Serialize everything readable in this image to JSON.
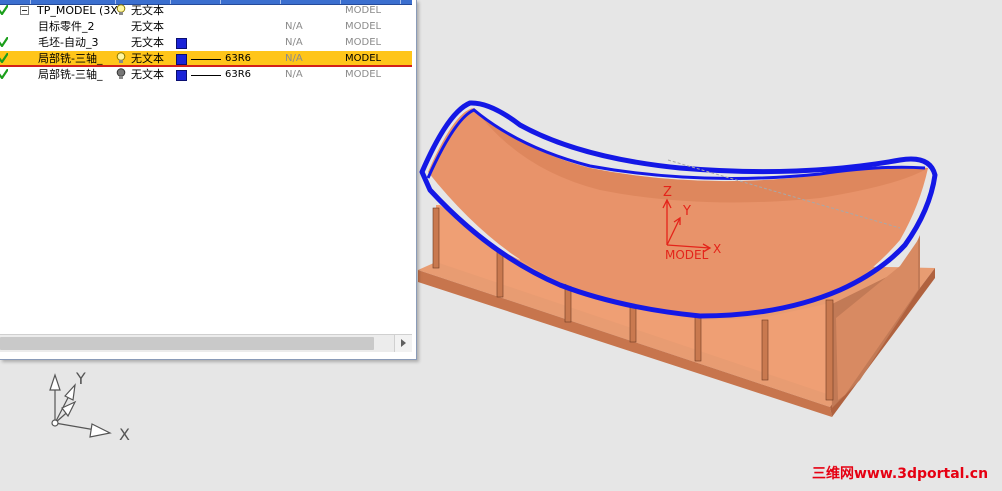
{
  "navigator": {
    "rows": [
      {
        "name": "TP_MODEL (3X",
        "text": "无文本",
        "na": "",
        "model": "MODEL",
        "bulb": "on",
        "check": true,
        "expander": true
      },
      {
        "name": "目标零件_2",
        "text": "无文本",
        "na": "N/A",
        "model": "MODEL",
        "check": false
      },
      {
        "name": "毛坯-自动_3",
        "text": "无文本",
        "na": "N/A",
        "model": "MODEL",
        "check": true,
        "color": true
      },
      {
        "name": "局部铣-三轴_",
        "text": "无文本",
        "line": "63R6",
        "na": "N/A",
        "model": "MODEL",
        "bulb": "on",
        "check": true,
        "color": true,
        "selected": true
      },
      {
        "name": "局部铣-三轴_",
        "text": "无文本",
        "line": "63R6",
        "na": "N/A",
        "model": "MODEL",
        "bulb": "off",
        "check": true,
        "color": true
      }
    ]
  },
  "viewport": {
    "part_triad_labels": {
      "z": "Z",
      "y": "Y",
      "x": "X",
      "model": "MODEL"
    },
    "view_triad_labels": {
      "y": "Y",
      "x": "X"
    }
  },
  "watermark": "三维网www.3dportal.cn",
  "colors": {
    "part_fill": "#e8976a",
    "part_dark": "#c8744c",
    "curve_blue": "#1418e6",
    "triad_red": "#e4241a",
    "selection": "#ffc51a",
    "header_blue": "#3b6fcf"
  }
}
